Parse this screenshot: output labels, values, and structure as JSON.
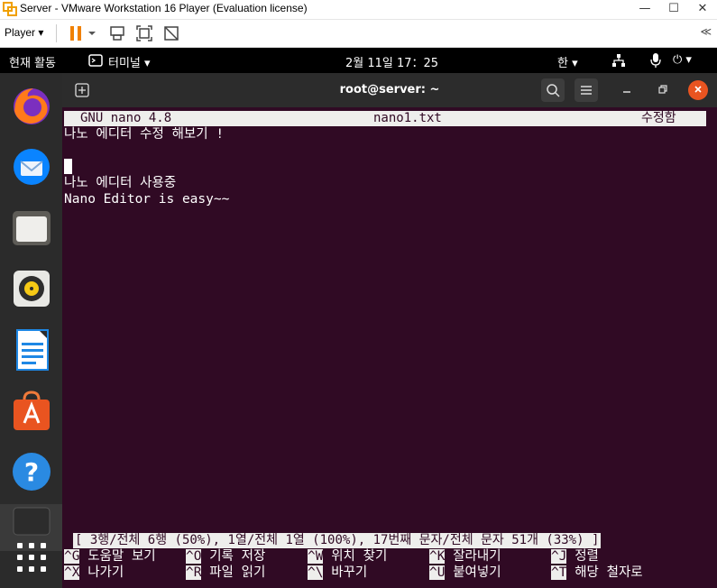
{
  "window": {
    "title": "Server - VMware Workstation 16 Player (Evaluation license)",
    "minimize": "—",
    "maximize": "☐",
    "close": "✕"
  },
  "toolbar": {
    "player_label": "Player ▾",
    "collapse": "≪"
  },
  "topbar": {
    "activities": "현재 활동",
    "app_menu": "터미널 ▾",
    "clock": "2월 11일  17：25",
    "ime": "한 ▾",
    "system": "⏻ ▾"
  },
  "dock": {
    "items": [
      "Firefox",
      "Thunderbird",
      "Files",
      "Rhythmbox",
      "LibreOffice Writer",
      "Ubuntu Software",
      "Help",
      "Terminal",
      "Show Applications"
    ]
  },
  "terminal": {
    "title": "root@server: ~",
    "nano": {
      "version": "GNU nano 4.8",
      "filename": "nano1.txt",
      "state": "수정함",
      "lines": [
        "나노 에디터 수정 해보기 !",
        "",
        "",
        "나노 에디터 사용중",
        "Nano Editor is easy~~"
      ],
      "status": "[ 3행/전체 6행 (50%), 1열/전체 1열 (100%), 17번째 문자/전체 문자 51개 (33%) ]",
      "shortcuts_row1": [
        {
          "key": "^G",
          "label": "도움말 보기"
        },
        {
          "key": "^O",
          "label": "기록 저장"
        },
        {
          "key": "^W",
          "label": "위치 찾기"
        },
        {
          "key": "^K",
          "label": "잘라내기"
        },
        {
          "key": "^J",
          "label": "정렬"
        }
      ],
      "shortcuts_row2": [
        {
          "key": "^X",
          "label": "나가기"
        },
        {
          "key": "^R",
          "label": "파일 읽기"
        },
        {
          "key": "^\\",
          "label": "바꾸기"
        },
        {
          "key": "^U",
          "label": "붙여넣기"
        },
        {
          "key": "^T",
          "label": "해당 철자로"
        }
      ]
    }
  },
  "colors": {
    "terminal_bg": "#300a24",
    "dock_bg": "#2b2b2b",
    "close_btn": "#e95420"
  }
}
